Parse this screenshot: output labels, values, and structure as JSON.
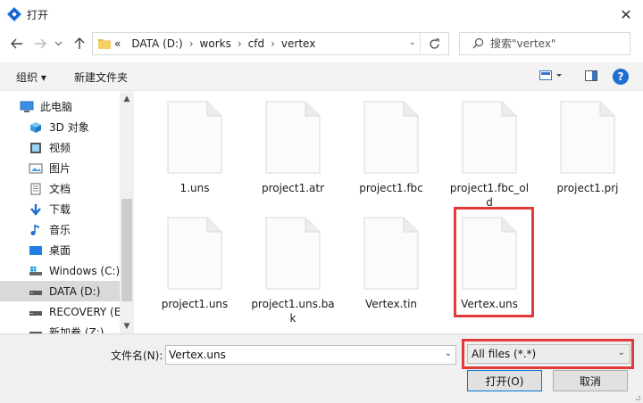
{
  "window": {
    "title": "打开"
  },
  "nav": {
    "back_icon": "arrow-left-icon",
    "forward_icon": "arrow-right-icon",
    "recent_icon": "chevron-down-icon",
    "up_icon": "arrow-up-icon",
    "overflow": "«",
    "breadcrumb": [
      "DATA (D:)",
      "works",
      "cfd",
      "vertex"
    ],
    "search_placeholder": "搜索\"vertex\""
  },
  "toolbar": {
    "organize_label": "组织 ▾",
    "new_folder_label": "新建文件夹"
  },
  "sidebar": {
    "items": [
      {
        "label": "此电脑",
        "icon": "computer-icon"
      },
      {
        "label": "3D 对象",
        "icon": "cube-icon"
      },
      {
        "label": "视频",
        "icon": "video-icon"
      },
      {
        "label": "图片",
        "icon": "pictures-icon"
      },
      {
        "label": "文档",
        "icon": "documents-icon"
      },
      {
        "label": "下载",
        "icon": "download-icon"
      },
      {
        "label": "音乐",
        "icon": "music-icon"
      },
      {
        "label": "桌面",
        "icon": "desktop-icon"
      },
      {
        "label": "Windows (C:)",
        "icon": "windows-drive-icon"
      },
      {
        "label": "DATA (D:)",
        "icon": "drive-icon",
        "selected": true
      },
      {
        "label": "RECOVERY (E:)",
        "icon": "drive-icon"
      },
      {
        "label": "新加卷 (Z:)",
        "icon": "drive-icon"
      }
    ]
  },
  "files": [
    {
      "name": "1.uns"
    },
    {
      "name": "project1.atr"
    },
    {
      "name": "project1.fbc"
    },
    {
      "name": "project1.fbc_old"
    },
    {
      "name": "project1.prj"
    },
    {
      "name": "project1.uns"
    },
    {
      "name": "project1.uns.bak"
    },
    {
      "name": "Vertex.tin"
    },
    {
      "name": "Vertex.uns",
      "highlighted": true
    }
  ],
  "bottom": {
    "filename_label": "文件名(N):",
    "filename_value": "Vertex.uns",
    "filetype_value": "All files (*.*)",
    "open_label": "打开(O)",
    "cancel_label": "取消"
  },
  "colors": {
    "highlight": "#e23a3a",
    "accent": "#0078d7",
    "selected": "#d9d9d9"
  }
}
